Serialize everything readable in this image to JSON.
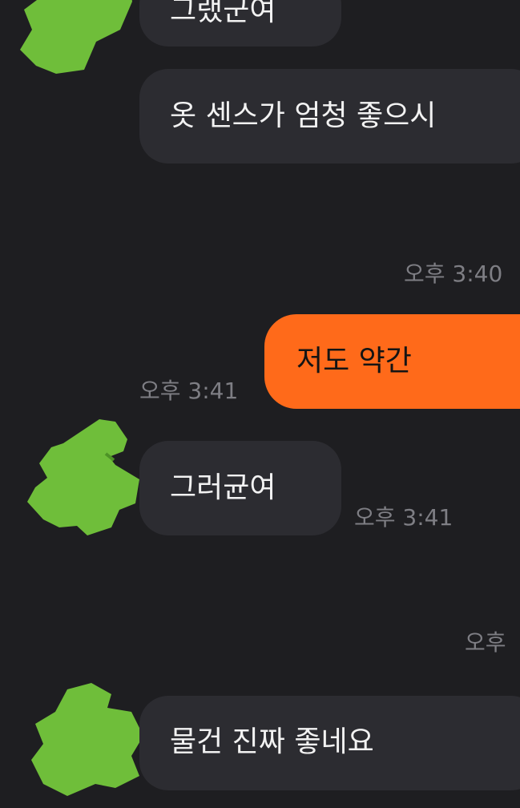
{
  "messages": {
    "m1_text": "그랬군여",
    "m2_text": "옷 센스가 엄청 좋으시",
    "ts_m2": "오후 3:40",
    "mine_text": "저도 약간",
    "ts_mine": "오후 3:41",
    "m3_text": "그러균여",
    "ts_m3": "오후 3:41",
    "ts_m4": "오후",
    "m4_text": "물건 진짜 좋네요"
  },
  "colors": {
    "background": "#1e1e21",
    "incoming_bubble": "#2c2c31",
    "outgoing_bubble": "#ff6a1a",
    "avatar_green": "#6fbe3a"
  },
  "icons": {
    "avatar": "green-clover-avatar-icon"
  }
}
